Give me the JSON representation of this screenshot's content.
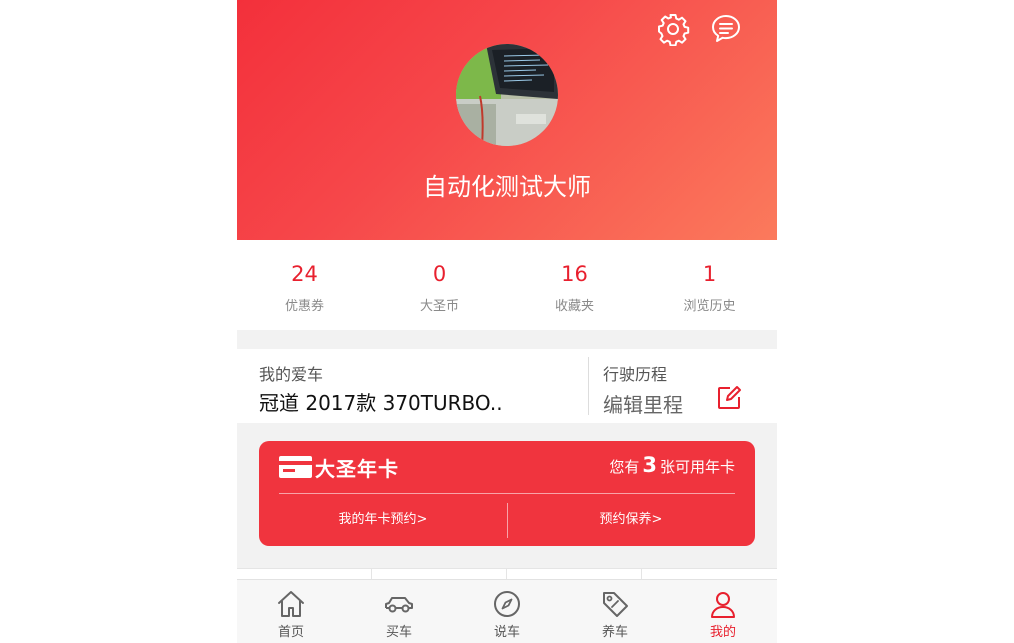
{
  "profile": {
    "username": "自动化测试大师"
  },
  "header": {
    "settings_icon": "gear-icon",
    "message_icon": "chat-bubble-icon"
  },
  "stats": [
    {
      "value": "24",
      "label": "优惠券"
    },
    {
      "value": "0",
      "label": "大圣币"
    },
    {
      "value": "16",
      "label": "收藏夹"
    },
    {
      "value": "1",
      "label": "浏览历史"
    }
  ],
  "my_car": {
    "label": "我的爱车",
    "name": "冠道 2017款 370TURBO.."
  },
  "mileage": {
    "label": "行驶历程",
    "edit": "编辑里程"
  },
  "year_card": {
    "title": "大圣年卡",
    "count_prefix": "您有",
    "count": "3",
    "count_suffix": "张可用年卡",
    "link_reservation": "我的年卡预约>",
    "link_maintenance": "预约保养>"
  },
  "tabbar": [
    {
      "label": "首页",
      "icon": "home-icon"
    },
    {
      "label": "买车",
      "icon": "car-icon"
    },
    {
      "label": "说车",
      "icon": "compass-icon"
    },
    {
      "label": "养车",
      "icon": "tag-icon"
    },
    {
      "label": "我的",
      "icon": "user-icon",
      "active": true
    }
  ],
  "colors": {
    "accent": "#e8202e",
    "header_start": "#f3303b",
    "header_end": "#fb7a5c",
    "card_red": "#f0343e"
  }
}
